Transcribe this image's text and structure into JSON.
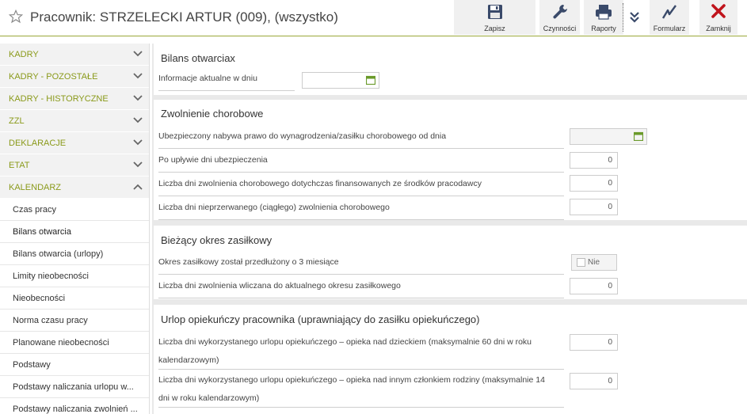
{
  "header": {
    "title": "Pracownik: STRZELECKI ARTUR (009), (wszystko)",
    "toolbar": {
      "zapisz": "Zapisz",
      "czynnosci": "Czynności",
      "raporty": "Raporty",
      "formularz": "Formularz",
      "zamknij": "Zamknij"
    }
  },
  "sidebar": {
    "sections": [
      "KADRY",
      "KADRY - POZOSTAŁE",
      "KADRY - HISTORYCZNE",
      "ZZL",
      "DEKLARACJE",
      "ETAT",
      "KALENDARZ"
    ],
    "items": [
      "Czas pracy",
      "Bilans otwarcia",
      "Bilans otwarcia (urlopy)",
      "Limity nieobecności",
      "Nieobecności",
      "Norma czasu pracy",
      "Planowane nieobecności",
      "Podstawy",
      "Podstawy naliczania urlopu w...",
      "Podstawy naliczania zwolnień ..."
    ]
  },
  "main": {
    "bilans": {
      "title": "Bilans otwarciax",
      "label": "Informacje aktualne w dniu",
      "value": ""
    },
    "zwolnienie": {
      "title": "Zwolnienie chorobowe",
      "r1": "Ubezpieczony nabywa prawo do wynagrodzenia/zasiłku chorobowego od dnia",
      "r2": "Po upływie dni ubezpieczenia",
      "r2v": "0",
      "r3": "Liczba dni zwolnienia chorobowego dotychczas finansowanych ze środków pracodawcy",
      "r3v": "0",
      "r4": "Liczba dni nieprzerwanego (ciągłego) zwolnienia chorobowego",
      "r4v": "0"
    },
    "zasilkowy": {
      "title": "Bieżący okres zasiłkowy",
      "r1": "Okres zasiłkowy został przedłużony o 3 miesiące",
      "r1v": "Nie",
      "r2": "Liczba dni zwolnienia wliczana do aktualnego okresu zasiłkowego",
      "r2v": "0"
    },
    "opiekunczy": {
      "title": "Urlop opiekuńczy pracownika (uprawniający do zasiłku opiekuńczego)",
      "r1a": "Liczba dni wykorzystanego urlopu opiekuńczego – opieka nad dzieckiem (maksymalnie 60 dni w roku",
      "r1b": "kalendarzowym)",
      "r1v": "0",
      "r2a": "Liczba dni wykorzystanego urlopu opiekuńczego – opieka nad innym członkiem rodziny (maksymalnie 14",
      "r2b": "dni w roku kalendarzowym)",
      "r2v": "0"
    }
  },
  "colors": {
    "accent": "#8a9a1a",
    "close": "#c0141c",
    "toolbar_bg": "#f0f0f0",
    "calendar": "#6a9a2a"
  }
}
